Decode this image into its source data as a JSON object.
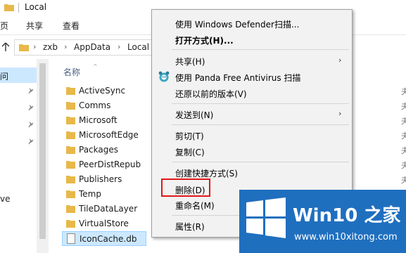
{
  "window": {
    "title": "Local"
  },
  "ribbon": {
    "tabs": [
      "页",
      "共享",
      "查看"
    ]
  },
  "address": {
    "crumbs": [
      "zxb",
      "AppData",
      "Local"
    ]
  },
  "nav": {
    "selected_label": "问",
    "other_label": "ve"
  },
  "files": {
    "column_header": "名称",
    "items": [
      "ActiveSync",
      "Comms",
      "Microsoft",
      "MicrosoftEdge",
      "Packages",
      "PeerDistRepub",
      "Publishers",
      "Temp",
      "TileDataLayer",
      "VirtualStore",
      "IconCache.db"
    ],
    "right_fragment": "夫"
  },
  "context_menu": {
    "items": [
      {
        "label": "使用 Windows Defender扫描...",
        "bold": false,
        "arrow": false
      },
      {
        "label": "打开方式(H)...",
        "bold": true,
        "arrow": false
      },
      {
        "label": "共享(H)",
        "bold": false,
        "arrow": true
      },
      {
        "label": "使用 Panda Free Antivirus 扫描",
        "bold": false,
        "arrow": false,
        "icon": "panda-icon"
      },
      {
        "label": "还原以前的版本(V)",
        "bold": false,
        "arrow": false
      },
      {
        "label": "发送到(N)",
        "bold": false,
        "arrow": true
      },
      {
        "label": "剪切(T)",
        "bold": false,
        "arrow": false
      },
      {
        "label": "复制(C)",
        "bold": false,
        "arrow": false
      },
      {
        "label": "创建快捷方式(S)",
        "bold": false,
        "arrow": false
      },
      {
        "label": "删除(D)",
        "bold": false,
        "arrow": false,
        "highlighted": true
      },
      {
        "label": "重命名(M)",
        "bold": false,
        "arrow": false
      },
      {
        "label": "属性(R)",
        "bold": false,
        "arrow": false
      }
    ]
  },
  "watermark": {
    "brand": "Win10 之家",
    "site": "www.win10xitong.com"
  },
  "colors": {
    "accent": "#0078d7",
    "highlight": "#e01818",
    "folder": "#e8b84a",
    "watermark_bg": "#1f6fbf"
  }
}
